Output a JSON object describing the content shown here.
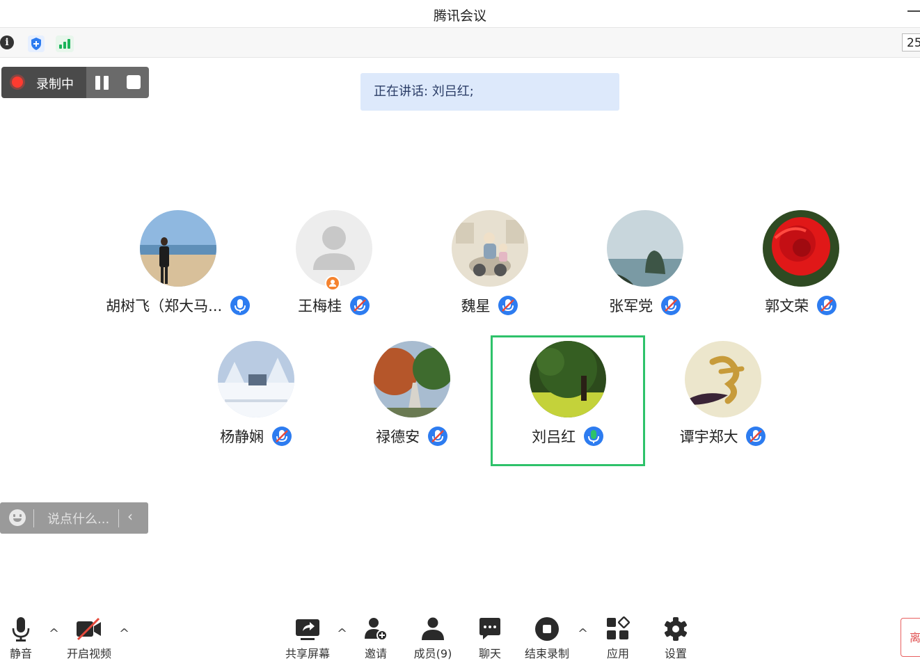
{
  "window": {
    "title": "腾讯会议"
  },
  "statusbar": {
    "timer": "25"
  },
  "recording": {
    "label": "录制中"
  },
  "speaking": {
    "text": "正在讲话: 刘吕红;"
  },
  "participants": [
    {
      "name": "胡树飞（郑大马...",
      "mic": "unmuted"
    },
    {
      "name": "王梅桂",
      "mic": "muted"
    },
    {
      "name": "魏星",
      "mic": "muted"
    },
    {
      "name": "张军党",
      "mic": "muted"
    },
    {
      "name": "郭文荣",
      "mic": "muted"
    },
    {
      "name": "杨静娴",
      "mic": "muted"
    },
    {
      "name": "禄德安",
      "mic": "muted"
    },
    {
      "name": "刘吕红",
      "mic": "speaking"
    },
    {
      "name": "谭宇郑大",
      "mic": "muted"
    }
  ],
  "chat": {
    "placeholder": "说点什么..."
  },
  "toolbar": {
    "mute": "静音",
    "video": "开启视频",
    "share": "共享屏幕",
    "invite": "邀请",
    "members": "成员(9)",
    "chat": "聊天",
    "end_record": "结束录制",
    "apps": "应用",
    "settings": "设置",
    "leave": "离开"
  },
  "colors": {
    "accent": "#2d7cf0",
    "speaking": "#2ec26a",
    "record": "#ff3b30",
    "leave": "#e05050"
  }
}
